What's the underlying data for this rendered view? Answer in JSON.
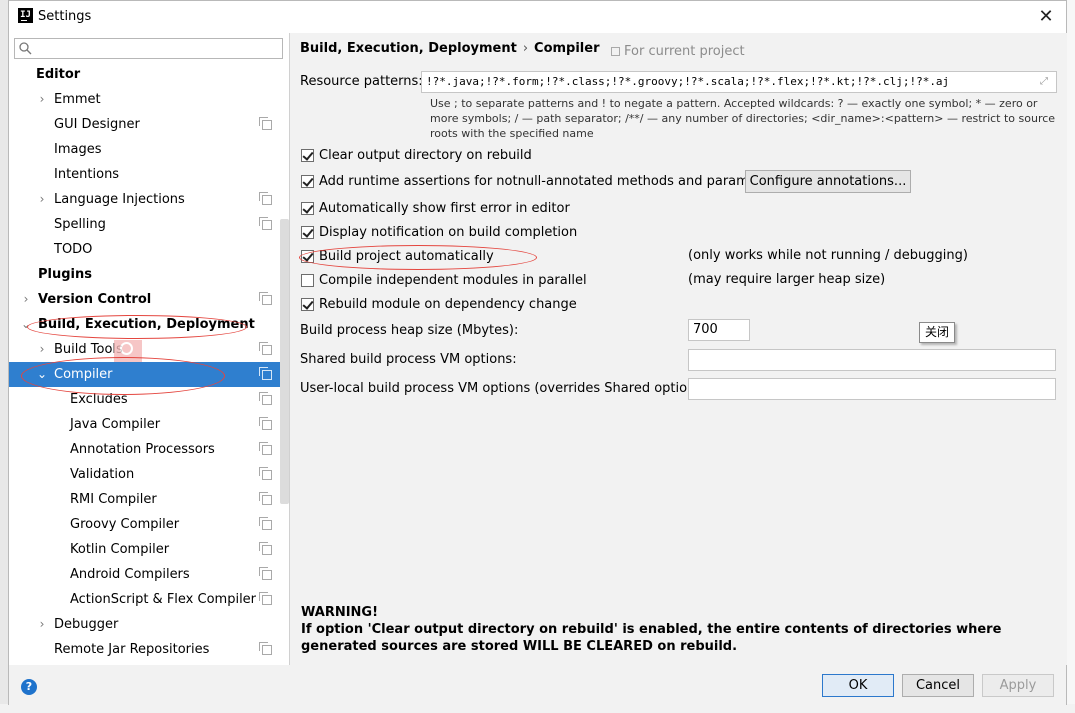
{
  "window": {
    "title": "Settings",
    "app_icon_text": "IJ",
    "close": "✕"
  },
  "sidebar": {
    "search_placeholder": "",
    "items": [
      {
        "label": "Editor"
      },
      {
        "label": "Emmet"
      },
      {
        "label": "GUI Designer"
      },
      {
        "label": "Images"
      },
      {
        "label": "Intentions"
      },
      {
        "label": "Language Injections"
      },
      {
        "label": "Spelling"
      },
      {
        "label": "TODO"
      },
      {
        "label": "Plugins"
      },
      {
        "label": "Version Control"
      },
      {
        "label": "Build, Execution, Deployment"
      },
      {
        "label": "Build Tools"
      },
      {
        "label": "Compiler"
      },
      {
        "label": "Excludes"
      },
      {
        "label": "Java Compiler"
      },
      {
        "label": "Annotation Processors"
      },
      {
        "label": "Validation"
      },
      {
        "label": "RMI Compiler"
      },
      {
        "label": "Groovy Compiler"
      },
      {
        "label": "Kotlin Compiler"
      },
      {
        "label": "Android Compilers"
      },
      {
        "label": "ActionScript & Flex Compiler"
      },
      {
        "label": "Debugger"
      },
      {
        "label": "Remote Jar Repositories"
      }
    ]
  },
  "header": {
    "crumb_parent": "Build, Execution, Deployment",
    "crumb_sep": "›",
    "crumb_current": "Compiler",
    "for_project": "For current project"
  },
  "compiler": {
    "resource_patterns_label": "Resource patterns:",
    "resource_patterns_value": "!?*.java;!?*.form;!?*.class;!?*.groovy;!?*.scala;!?*.flex;!?*.kt;!?*.clj;!?*.aj",
    "hint": "Use ; to separate patterns and ! to negate a pattern. Accepted wildcards: ? — exactly one symbol; * — zero or more symbols; / — path separator; /**/ — any number of directories; <dir_name>:<pattern> — restrict to source roots with the specified name",
    "options": [
      {
        "label": "Clear output directory on rebuild",
        "checked": true
      },
      {
        "label": "Add runtime assertions for notnull-annotated methods and parameters",
        "checked": true
      },
      {
        "label": "Automatically show first error in editor",
        "checked": true
      },
      {
        "label": "Display notification on build completion",
        "checked": true
      },
      {
        "label": "Build project automatically",
        "checked": true
      },
      {
        "label": "Compile independent modules in parallel",
        "checked": false
      },
      {
        "label": "Rebuild module on dependency change",
        "checked": true
      }
    ],
    "configure_annotations": "Configure annotations...",
    "note_build_auto": "(only works while not running / debugging)",
    "note_parallel": "(may require larger heap size)",
    "heap_label": "Build process heap size (Mbytes):",
    "heap_value": "700",
    "shared_vm_label": "Shared build process VM options:",
    "shared_vm_value": "",
    "local_vm_label": "User-local build process VM options (overrides Shared options):",
    "local_vm_value": "",
    "tooltip": "关闭",
    "warning_title": "WARNING!",
    "warning_body": "If option 'Clear output directory on rebuild' is enabled, the entire contents of directories where generated sources are stored WILL BE CLEARED on rebuild."
  },
  "footer": {
    "help": "?",
    "ok": "OK",
    "cancel": "Cancel",
    "apply": "Apply"
  },
  "colors": {
    "selection": "#2f7fcf",
    "annotation_red": "#e4463f",
    "help_blue": "#1f73cc"
  }
}
